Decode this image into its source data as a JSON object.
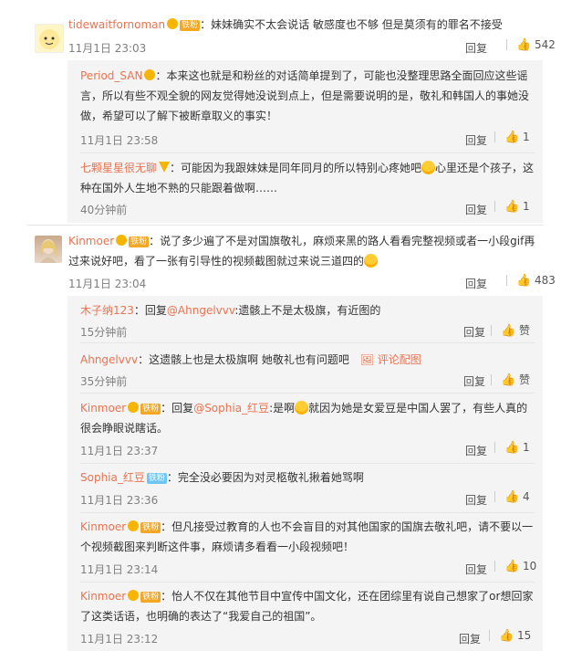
{
  "comments": [
    {
      "user": "tidewaitfornoman",
      "badge": "铁粉",
      "text": "：妹妹确实不太会说话 敏感度也不够 但是莫须有的罪名不接受",
      "time": "11月1日 23:03",
      "reply": "回复",
      "likes": "542",
      "replies": [
        {
          "user": "Period_SAN",
          "text": "：本来这也就是和粉丝的对话简单提到了，可能也没整理思路全面回应这些谣言，所以有些不观全貌的网友觉得她没说到点上，但是需要说明的是，敬礼和韩国人的事她没做，希望可以了解下被断章取义的事实！",
          "time": "11月1日 23:58",
          "reply": "回复",
          "likes": "1"
        },
        {
          "user": "七颗星星很无聊",
          "text": "：可能因为我跟妹妹是同年同月的所以特别心疼她吧",
          "text2": "心里还是个孩子，这种在国外人生地不熟的只能跟着做啊……",
          "time": "40分钟前",
          "reply": "回复",
          "likes": "1"
        }
      ]
    },
    {
      "user": "Kinmoer",
      "badge": "铁粉",
      "text": "：说了多少遍了不是对国旗敬礼，麻烦来黑的路人看看完整视频或者一小段gif再过来说好吧，看了一张有引导性的视频截图就过来说三道四的",
      "time": "11月1日 23:04",
      "reply": "回复",
      "likes": "483",
      "replies": [
        {
          "user": "木子纳123",
          "text": "：回复",
          "mention": "@Ahngelvvv",
          "text_after": ":遗骸上不是太极旗，有近图的",
          "time": "15分钟前",
          "reply": "回复",
          "likes": "赞"
        },
        {
          "user": "Ahngelvvv",
          "text": "：这遗骸上也是太极旗啊 她敬礼也有问题吧",
          "extra": "评论配图",
          "time": "35分钟前",
          "reply": "回复",
          "likes": "赞"
        },
        {
          "user": "Kinmoer",
          "badge": "铁粉",
          "text": "：回复",
          "mention": "@Sophia_红豆",
          "text_after": ":是啊",
          "text2": "就因为她是女爱豆是中国人罢了，有些人真的很会睁眼说瞎话。",
          "time": "11月1日 23:37",
          "reply": "回复",
          "likes": "1"
        },
        {
          "user": "Sophia_红豆",
          "badge": "铁粉",
          "text": "：完全没必要因为对灵柩敬礼揪着她骂啊",
          "time": "11月1日 23:36",
          "reply": "回复",
          "likes": "4"
        },
        {
          "user": "Kinmoer",
          "badge": "铁粉",
          "text": "：但凡接受过教育的人也不会盲目的对其他国家的国旗去敬礼吧，请不要以一个视频截图来判断这件事，麻烦请多看看一小段视频吧！",
          "time": "11月1日 23:14",
          "reply": "回复",
          "likes": "10"
        },
        {
          "user": "Kinmoer",
          "badge": "铁粉",
          "text": "：怡人不仅在其他节目中宣传中国文化，还在团综里有说自己想家了or想回家了这类话语，也明确的表达了“我爱自己的祖国”。",
          "time": "11月1日 23:12",
          "reply": "回复",
          "likes": "15"
        }
      ]
    }
  ]
}
